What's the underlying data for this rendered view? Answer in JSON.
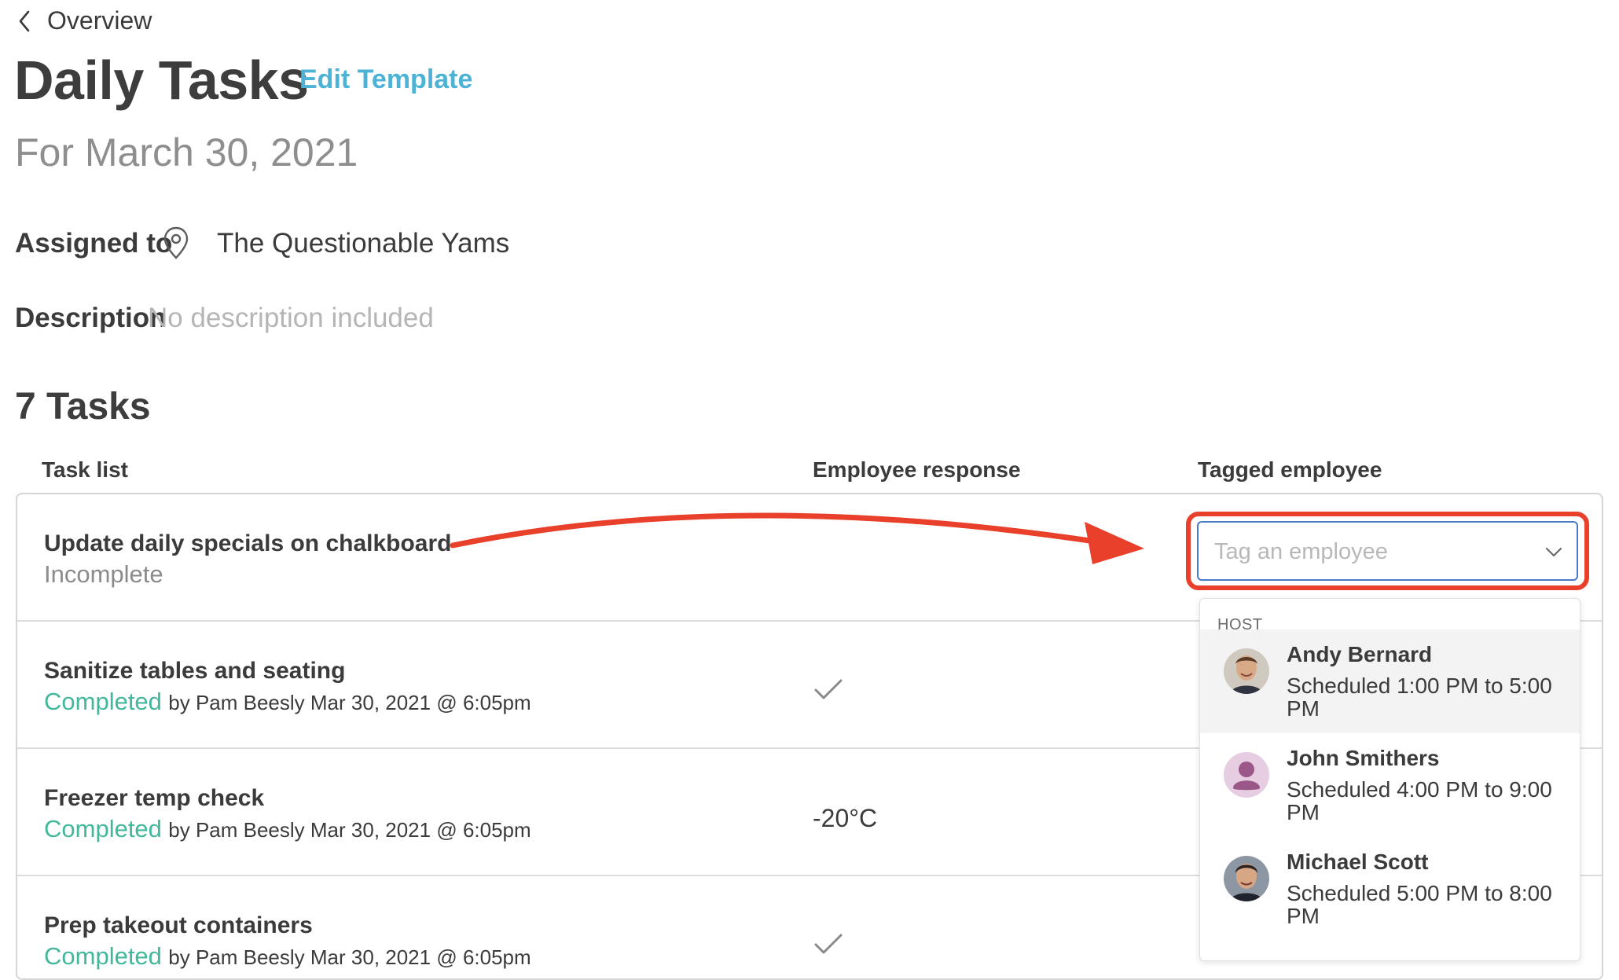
{
  "nav": {
    "back_label": "Overview"
  },
  "header": {
    "title": "Daily Tasks",
    "edit_label": "Edit Template",
    "date": "For March 30, 2021"
  },
  "details": {
    "assigned_label": "Assigned to",
    "assigned_value": "The Questionable Yams",
    "description_label": "Description",
    "description_value": "No description included"
  },
  "tasks": {
    "count_label": "7 Tasks",
    "columns": [
      "Task list",
      "Employee response",
      "Tagged employee"
    ],
    "rows": [
      {
        "name": "Update daily specials on chalkboard",
        "status": "Incomplete",
        "by": "",
        "response": ""
      },
      {
        "name": "Sanitize tables and seating",
        "status": "Completed",
        "by": "by Pam Beesly Mar 30, 2021 @ 6:05pm",
        "response": "check"
      },
      {
        "name": "Freezer temp check",
        "status": "Completed",
        "by": "by Pam Beesly Mar 30, 2021 @ 6:05pm",
        "response": "-20°C"
      },
      {
        "name": "Prep takeout containers",
        "status": "Completed",
        "by": "by Pam Beesly Mar 30, 2021 @ 6:05pm",
        "response": "check"
      }
    ]
  },
  "tag_select": {
    "placeholder": "Tag an employee",
    "group_label": "HOST",
    "options": [
      {
        "name": "Andy Bernard",
        "schedule": "Scheduled 1:00 PM to 5:00 PM",
        "avatar": "photo"
      },
      {
        "name": "John Smithers",
        "schedule": "Scheduled 4:00 PM to 9:00 PM",
        "avatar": "placeholder-person"
      },
      {
        "name": "Michael Scott",
        "schedule": "Scheduled 5:00 PM to 8:00 PM",
        "avatar": "photo"
      }
    ]
  },
  "colors": {
    "accent_link": "#4cb2d6",
    "completed": "#42b79c",
    "highlight": "#e8402a",
    "focus_border": "#4a79c9"
  },
  "icons": [
    "chevron-left-icon",
    "location-pin-icon",
    "checkmark-icon",
    "chevron-down-icon"
  ]
}
